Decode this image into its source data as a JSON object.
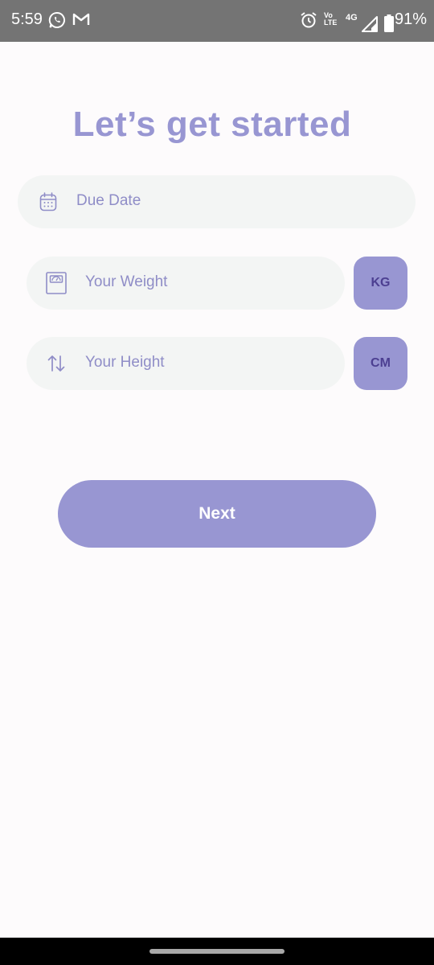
{
  "status_bar": {
    "time": "5:59",
    "network": "4G",
    "volte": "Vo LTE",
    "battery": "91%",
    "icons": [
      "whatsapp-icon",
      "gmail-icon",
      "alarm-icon",
      "signal-icon",
      "battery-icon"
    ]
  },
  "title": "Let’s get started",
  "fields": {
    "due_date": {
      "placeholder": "Due Date",
      "icon": "calendar-icon"
    },
    "weight": {
      "placeholder": "Your Weight",
      "icon": "scale-icon",
      "unit": "KG"
    },
    "height": {
      "placeholder": "Your Height",
      "icon": "up-down-arrows-icon",
      "unit": "CM"
    }
  },
  "next_label": "Next",
  "colors": {
    "accent": "#9896d2",
    "field_bg": "#f3f5f4",
    "unit_text": "#4c3f91",
    "placeholder": "#8f8dc7",
    "background": "#fdfbfc"
  }
}
